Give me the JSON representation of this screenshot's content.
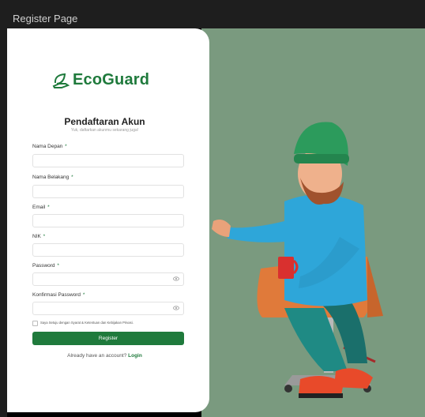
{
  "window": {
    "title": "Register Page"
  },
  "brand": {
    "name": "EcoGuard"
  },
  "form": {
    "title": "Pendaftaran Akun",
    "subtitle": "Yuk, daftarkan akunmu sekarang juga!",
    "fields": [
      {
        "label": "Nama Depan",
        "required": "*",
        "value": "",
        "placeholder": ""
      },
      {
        "label": "Nama Belakang",
        "required": "*",
        "value": "",
        "placeholder": ""
      },
      {
        "label": "Email",
        "required": "*",
        "value": "",
        "placeholder": ""
      },
      {
        "label": "NIK",
        "required": "*",
        "value": "",
        "placeholder": ""
      },
      {
        "label": "Password",
        "required": "*",
        "value": "",
        "placeholder": ""
      },
      {
        "label": "Konfirmasi  Password",
        "required": "*",
        "value": "",
        "placeholder": ""
      }
    ],
    "agree_text": "Saya Setuju dengan Syarat & Ketentuan dan Kebijakan Privasi.",
    "register_label": "Register",
    "login_prompt": "Already have an account?",
    "login_link": "Login"
  },
  "colors": {
    "accent": "#1f7a3c",
    "panel_bg": "#7a9a7f"
  }
}
